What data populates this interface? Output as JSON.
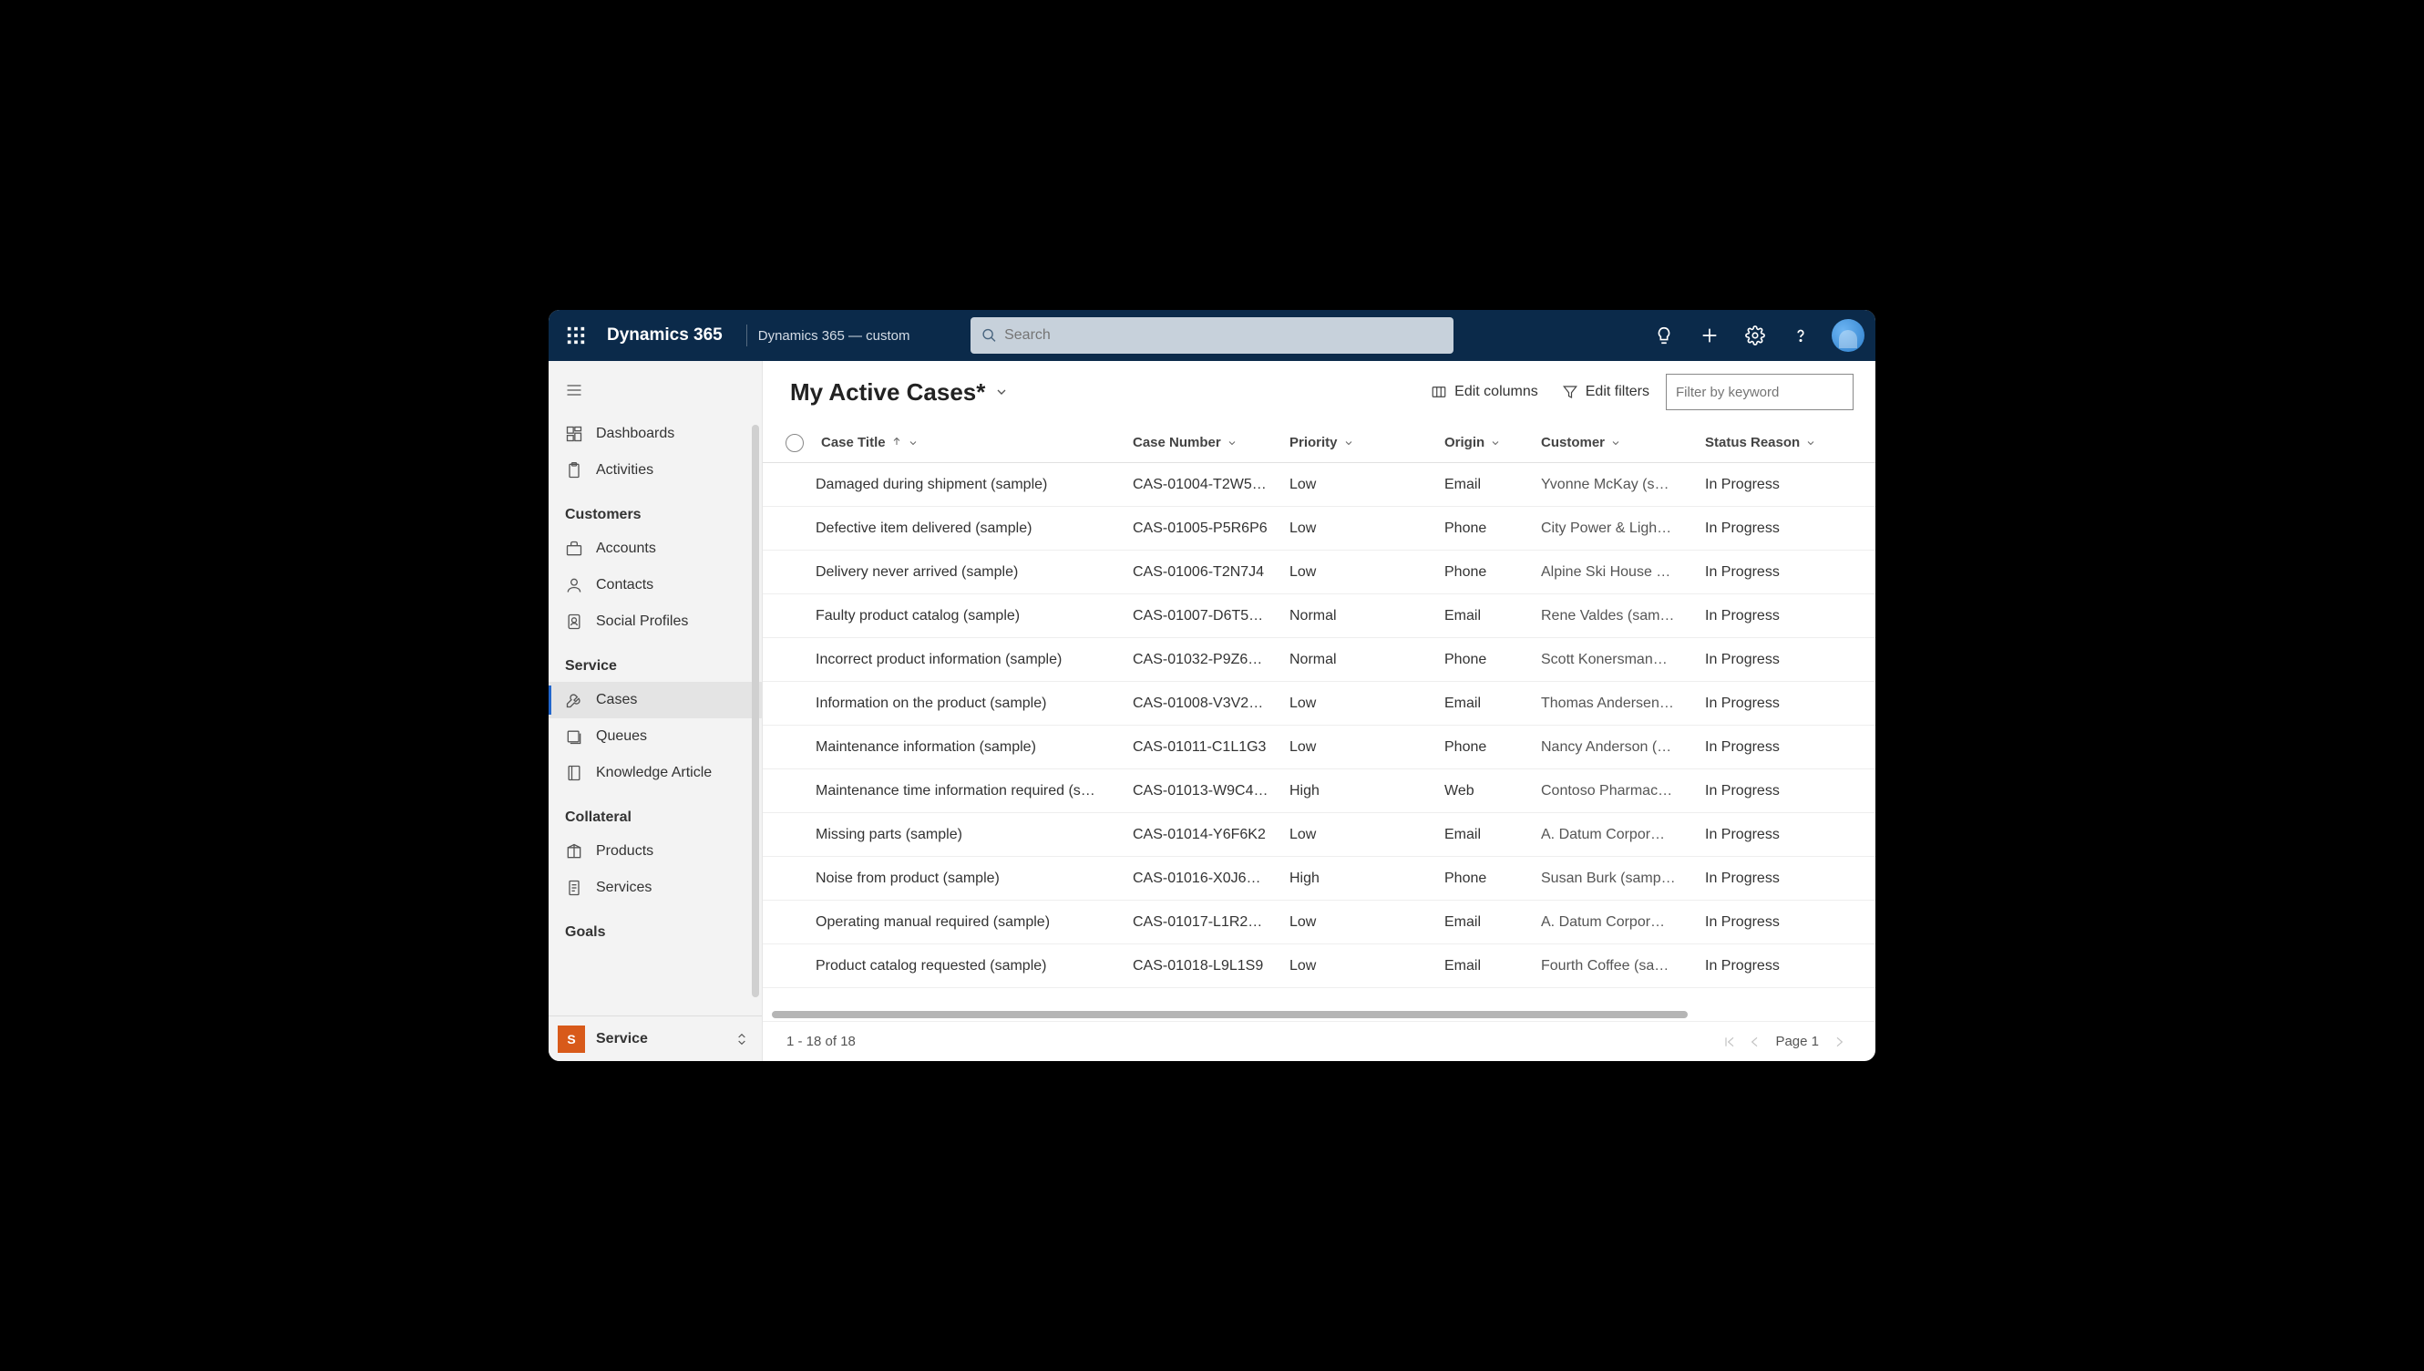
{
  "topnav": {
    "brand": "Dynamics 365",
    "environment": "Dynamics 365 — custom",
    "search_placeholder": "Search"
  },
  "sidebar": {
    "top_items": [
      {
        "label": "Dashboards",
        "icon": "dashboard"
      },
      {
        "label": "Activities",
        "icon": "clipboard"
      }
    ],
    "groups": [
      {
        "label": "Customers",
        "items": [
          {
            "label": "Accounts",
            "icon": "briefcase"
          },
          {
            "label": "Contacts",
            "icon": "person"
          },
          {
            "label": "Social Profiles",
            "icon": "badge"
          }
        ]
      },
      {
        "label": "Service",
        "items": [
          {
            "label": "Cases",
            "icon": "wrench",
            "active": true
          },
          {
            "label": "Queues",
            "icon": "queue"
          },
          {
            "label": "Knowledge Article",
            "icon": "book"
          }
        ]
      },
      {
        "label": "Collateral",
        "items": [
          {
            "label": "Products",
            "icon": "package"
          },
          {
            "label": "Services",
            "icon": "document"
          }
        ]
      },
      {
        "label": "Goals",
        "items": []
      }
    ],
    "area": {
      "badge": "S",
      "name": "Service"
    }
  },
  "toolbar": {
    "view_title": "My Active Cases*",
    "edit_columns": "Edit columns",
    "edit_filters": "Edit filters",
    "keyword_placeholder": "Filter by keyword"
  },
  "columns": [
    {
      "key": "title",
      "label": "Case Title",
      "sorted": "asc"
    },
    {
      "key": "number",
      "label": "Case Number"
    },
    {
      "key": "priority",
      "label": "Priority"
    },
    {
      "key": "origin",
      "label": "Origin"
    },
    {
      "key": "customer",
      "label": "Customer"
    },
    {
      "key": "status",
      "label": "Status Reason"
    }
  ],
  "rows": [
    {
      "title": "Damaged during shipment (sample)",
      "number": "CAS-01004-T2W5…",
      "priority": "Low",
      "origin": "Email",
      "customer": "Yvonne McKay (s…",
      "status": "In Progress"
    },
    {
      "title": "Defective item delivered (sample)",
      "number": "CAS-01005-P5R6P6",
      "priority": "Low",
      "origin": "Phone",
      "customer": "City Power & Ligh…",
      "status": "In Progress"
    },
    {
      "title": "Delivery never arrived (sample)",
      "number": "CAS-01006-T2N7J4",
      "priority": "Low",
      "origin": "Phone",
      "customer": "Alpine Ski House …",
      "status": "In Progress"
    },
    {
      "title": "Faulty product catalog (sample)",
      "number": "CAS-01007-D6T5…",
      "priority": "Normal",
      "origin": "Email",
      "customer": "Rene Valdes (sam…",
      "status": "In Progress"
    },
    {
      "title": "Incorrect product information (sample)",
      "number": "CAS-01032-P9Z6…",
      "priority": "Normal",
      "origin": "Phone",
      "customer": "Scott Konersman…",
      "status": "In Progress"
    },
    {
      "title": "Information on the product (sample)",
      "number": "CAS-01008-V3V2…",
      "priority": "Low",
      "origin": "Email",
      "customer": "Thomas Andersen…",
      "status": "In Progress"
    },
    {
      "title": "Maintenance information (sample)",
      "number": "CAS-01011-C1L1G3",
      "priority": "Low",
      "origin": "Phone",
      "customer": "Nancy Anderson (…",
      "status": "In Progress"
    },
    {
      "title": "Maintenance time information required (s…",
      "number": "CAS-01013-W9C4…",
      "priority": "High",
      "origin": "Web",
      "customer": "Contoso Pharmac…",
      "status": "In Progress"
    },
    {
      "title": "Missing parts (sample)",
      "number": "CAS-01014-Y6F6K2",
      "priority": "Low",
      "origin": "Email",
      "customer": "A. Datum Corpor…",
      "status": "In Progress"
    },
    {
      "title": "Noise from product (sample)",
      "number": "CAS-01016-X0J6…",
      "priority": "High",
      "origin": "Phone",
      "customer": "Susan Burk (samp…",
      "status": "In Progress"
    },
    {
      "title": "Operating manual required (sample)",
      "number": "CAS-01017-L1R2…",
      "priority": "Low",
      "origin": "Email",
      "customer": "A. Datum Corpor…",
      "status": "In Progress"
    },
    {
      "title": "Product catalog requested (sample)",
      "number": "CAS-01018-L9L1S9",
      "priority": "Low",
      "origin": "Email",
      "customer": "Fourth Coffee (sa…",
      "status": "In Progress"
    }
  ],
  "pager": {
    "range_text": "1 - 18 of 18",
    "page_label": "Page 1"
  }
}
